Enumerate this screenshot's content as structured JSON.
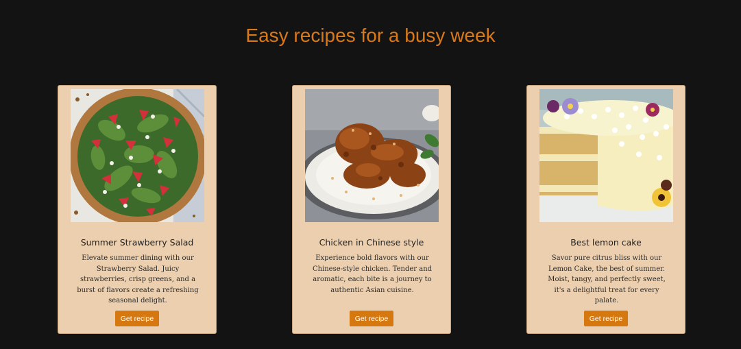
{
  "page": {
    "title": "Easy recipes for a busy week"
  },
  "recipes": [
    {
      "title": "Summer Strawberry Salad",
      "description": "Elevate summer dining with our Strawberry Salad. Juicy strawberries, crisp greens, and a burst of flavors create a refreshing seasonal delight.",
      "button": "Get recipe"
    },
    {
      "title": "Chicken in Chinese style",
      "description": "Experience bold flavors with our Chinese-style chicken. Tender and aromatic, each bite is a journey to authentic Asian cuisine.",
      "button": "Get recipe"
    },
    {
      "title": "Best lemon cake",
      "description": "Savor pure citrus bliss with our Lemon Cake, the best of summer. Moist, tangy, and perfectly sweet, it's a delightful treat for every palate.",
      "button": "Get recipe"
    }
  ],
  "colors": {
    "background": "#131313",
    "accent": "#d9791a",
    "card": "#eccfae",
    "button": "#d4780f"
  }
}
